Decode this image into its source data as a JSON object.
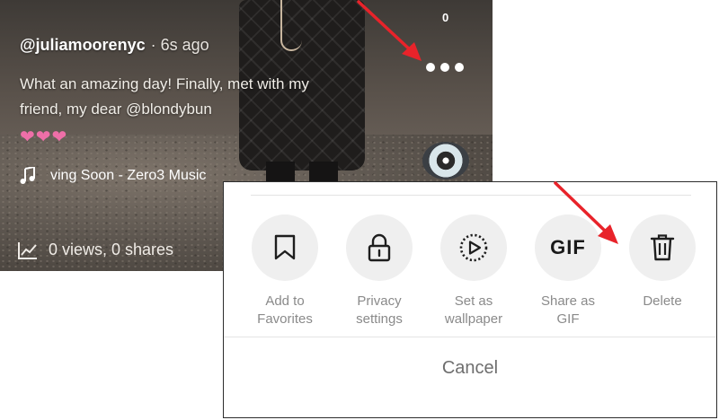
{
  "video": {
    "top_count": "0",
    "username": "@juliamoorenyc",
    "time_ago": "· 6s ago",
    "caption": "What an amazing day! Finally, met with my friend, my dear @blondybun",
    "hearts": "❤❤❤",
    "music_text": "ving Soon - Zero3 Music",
    "stats_text": "0 views, 0 shares"
  },
  "share_sheet": {
    "actions": [
      {
        "label": "Add to\nFavorites",
        "icon": "bookmark-icon"
      },
      {
        "label": "Privacy\nsettings",
        "icon": "lock-icon"
      },
      {
        "label": "Set as\nwallpaper",
        "icon": "play-circle-icon"
      },
      {
        "label": "Share as\nGIF",
        "icon": "gif-icon",
        "glyph": "GIF"
      },
      {
        "label": "Delete",
        "icon": "trash-icon"
      }
    ],
    "cancel_label": "Cancel"
  },
  "colors": {
    "annotation_arrow": "#e8232a",
    "heart": "#ee6fa8",
    "action_circle": "#efefef",
    "label_gray": "#8a8a8a"
  }
}
